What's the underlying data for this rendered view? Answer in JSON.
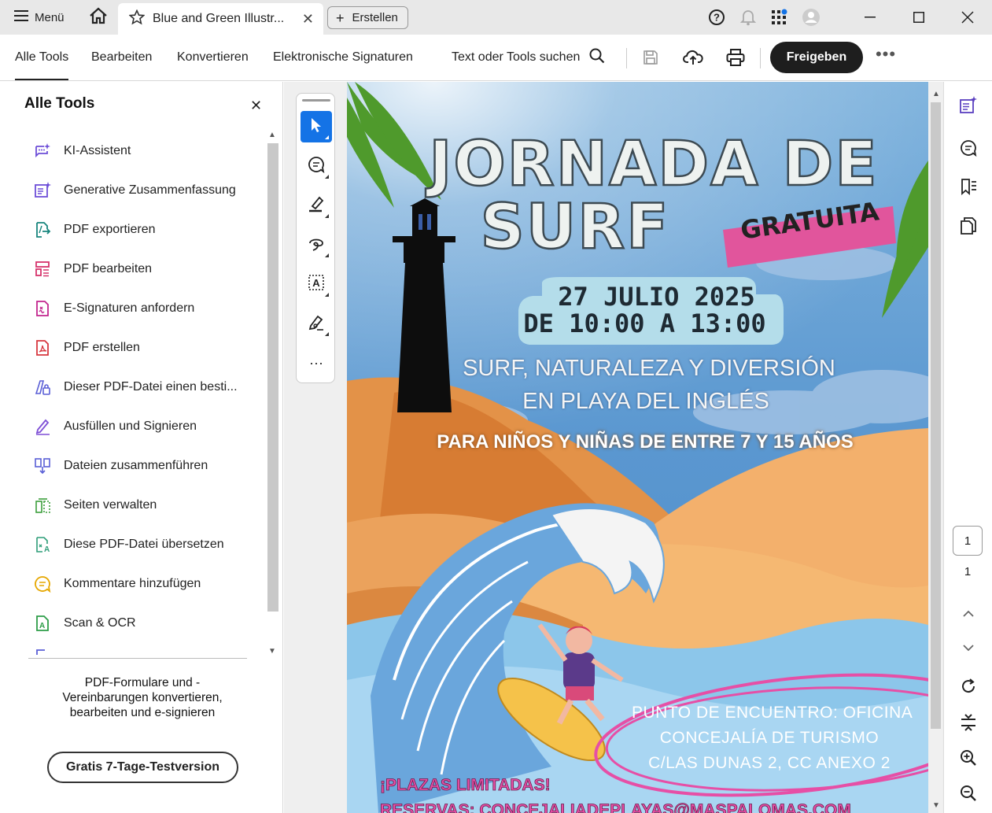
{
  "titlebar": {
    "menu_label": "Menü",
    "tab_title": "Blue and Green Illustr...",
    "create_label": "Erstellen"
  },
  "toolbar": {
    "tabs": [
      "Alle Tools",
      "Bearbeiten",
      "Konvertieren",
      "Elektronische Signaturen"
    ],
    "search_label": "Text oder Tools suchen",
    "share_label": "Freigeben",
    "accent": "#1473e6"
  },
  "leftpanel": {
    "title": "Alle Tools",
    "items": [
      {
        "label": "KI-Assistent",
        "icon": "ai-assistant-icon"
      },
      {
        "label": "Generative Zusammenfassung",
        "icon": "generative-summary-icon"
      },
      {
        "label": "PDF exportieren",
        "icon": "export-pdf-icon"
      },
      {
        "label": "PDF bearbeiten",
        "icon": "edit-pdf-icon"
      },
      {
        "label": "E-Signaturen anfordern",
        "icon": "request-signature-icon"
      },
      {
        "label": "PDF erstellen",
        "icon": "create-pdf-icon"
      },
      {
        "label": "Dieser PDF-Datei einen besti...",
        "icon": "protect-pdf-icon"
      },
      {
        "label": "Ausfüllen und Signieren",
        "icon": "fill-sign-icon"
      },
      {
        "label": "Dateien zusammenführen",
        "icon": "combine-files-icon"
      },
      {
        "label": "Seiten verwalten",
        "icon": "organize-pages-icon"
      },
      {
        "label": "Diese PDF-Datei übersetzen",
        "icon": "translate-pdf-icon"
      },
      {
        "label": "Kommentare hinzufügen",
        "icon": "comment-icon"
      },
      {
        "label": "Scan & OCR",
        "icon": "scan-ocr-icon"
      }
    ],
    "promo_text": "PDF-Formulare und -Vereinbarungen konvertieren, bearbeiten und e-signieren",
    "trial_label": "Gratis 7-Tage-Testversion"
  },
  "poster": {
    "title_line1": "JORNADA DE",
    "title_line2": "SURF",
    "badge": "GRATUITA",
    "date_line1": "27 JULIO 2025",
    "date_line2": "DE 10:00 A 13:00",
    "subtitle_line1": "SURF, NATURALEZA Y DIVERSIÓN",
    "subtitle_line2": "EN PLAYA DEL INGLÉS",
    "audience": "PARA NIÑOS Y NIÑAS DE ENTRE 7 Y 15 AÑOS",
    "meeting_line1": "PUNTO DE ENCUENTRO: OFICINA",
    "meeting_line2": "CONCEJALÍA DE TURISMO",
    "meeting_line3": "C/LAS DUNAS 2, CC ANEXO 2",
    "limited": "¡PLAZAS LIMITADAS!",
    "reservations": "RESERVAS: CONCEJALIADEPLAYAS@MASPALOMAS.COM"
  },
  "pagenav": {
    "current_page": "1",
    "total_pages": "1"
  }
}
